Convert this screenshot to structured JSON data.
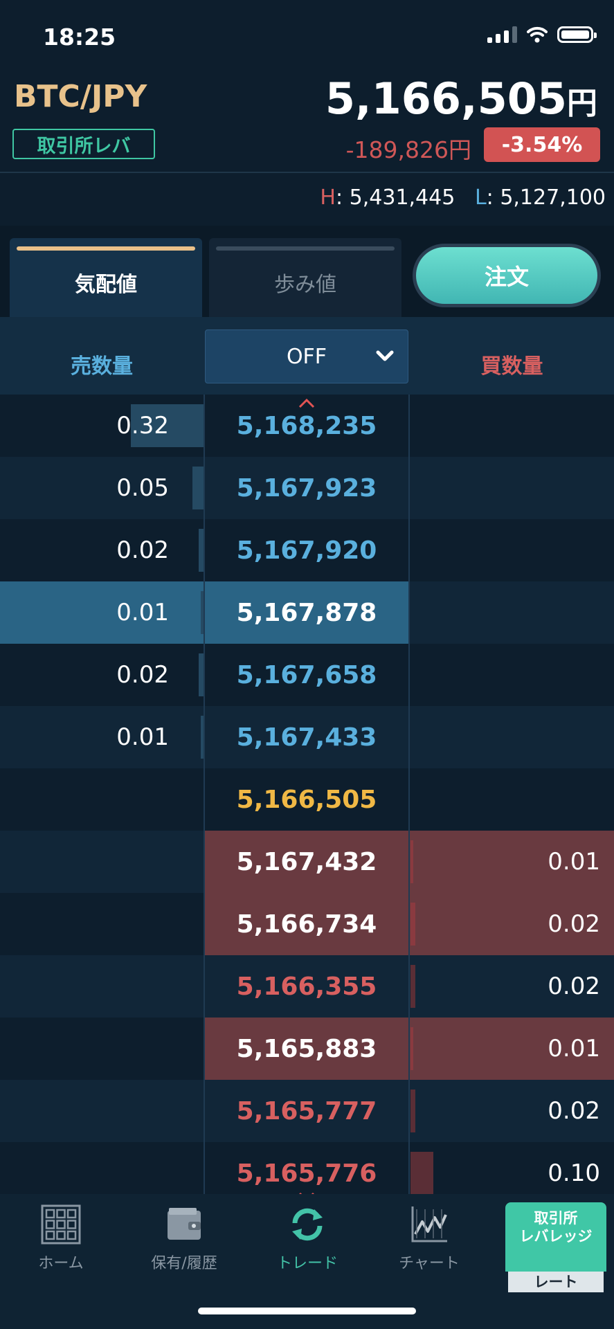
{
  "status_bar": {
    "time": "18:25"
  },
  "header": {
    "pair": "BTC/JPY",
    "market_badge": "取引所レバ",
    "price": "5,166,505",
    "price_unit": "円",
    "change": "-189,826円",
    "change_pct": "-3.54%",
    "high_label": "H",
    "high": "5,431,445",
    "low_label": "L",
    "low": "5,127,100"
  },
  "tabs": [
    {
      "label": "気配値",
      "active": true
    },
    {
      "label": "歩み値",
      "active": false
    }
  ],
  "order_button": "注文",
  "columns": {
    "sell_qty": "売数量",
    "grouping": "OFF",
    "buy_qty": "買数量"
  },
  "asks": [
    {
      "qty": "0.32",
      "price": "5,168,235",
      "depth": 0.32,
      "highlight": false
    },
    {
      "qty": "0.05",
      "price": "5,167,923",
      "depth": 0.05,
      "highlight": false
    },
    {
      "qty": "0.02",
      "price": "5,167,920",
      "depth": 0.02,
      "highlight": false
    },
    {
      "qty": "0.01",
      "price": "5,167,878",
      "depth": 0.01,
      "highlight": true
    },
    {
      "qty": "0.02",
      "price": "5,167,658",
      "depth": 0.02,
      "highlight": false
    },
    {
      "qty": "0.01",
      "price": "5,167,433",
      "depth": 0.01,
      "highlight": false
    }
  ],
  "last_price": "5,166,505",
  "bids": [
    {
      "qty": "0.01",
      "price": "5,167,432",
      "depth": 0.01,
      "highlight": true
    },
    {
      "qty": "0.02",
      "price": "5,166,734",
      "depth": 0.02,
      "highlight": true
    },
    {
      "qty": "0.02",
      "price": "5,166,355",
      "depth": 0.02,
      "highlight": false
    },
    {
      "qty": "0.01",
      "price": "5,165,883",
      "depth": 0.01,
      "highlight": true
    },
    {
      "qty": "0.02",
      "price": "5,165,777",
      "depth": 0.02,
      "highlight": false
    },
    {
      "qty": "0.10",
      "price": "5,165,776",
      "depth": 0.1,
      "highlight": false
    }
  ],
  "colors": {
    "ask_price": "#5ab0de",
    "bid_price": "#d86060",
    "last_price": "#f0b845",
    "ask_highlight_bg": "#2a6485",
    "bid_highlight_bg": "#693a40",
    "row_dark": "#0d1e2d",
    "row_light": "#112638"
  },
  "nav": [
    {
      "label": "ホーム",
      "icon": "grid-icon"
    },
    {
      "label": "保有/履歴",
      "icon": "wallet-icon"
    },
    {
      "label": "トレード",
      "icon": "refresh-icon",
      "active": true
    },
    {
      "label": "チャート",
      "icon": "chart-line-icon"
    }
  ],
  "rate_button": {
    "line1": "取引所",
    "line2": "レバレッジ",
    "line3": "レート"
  }
}
